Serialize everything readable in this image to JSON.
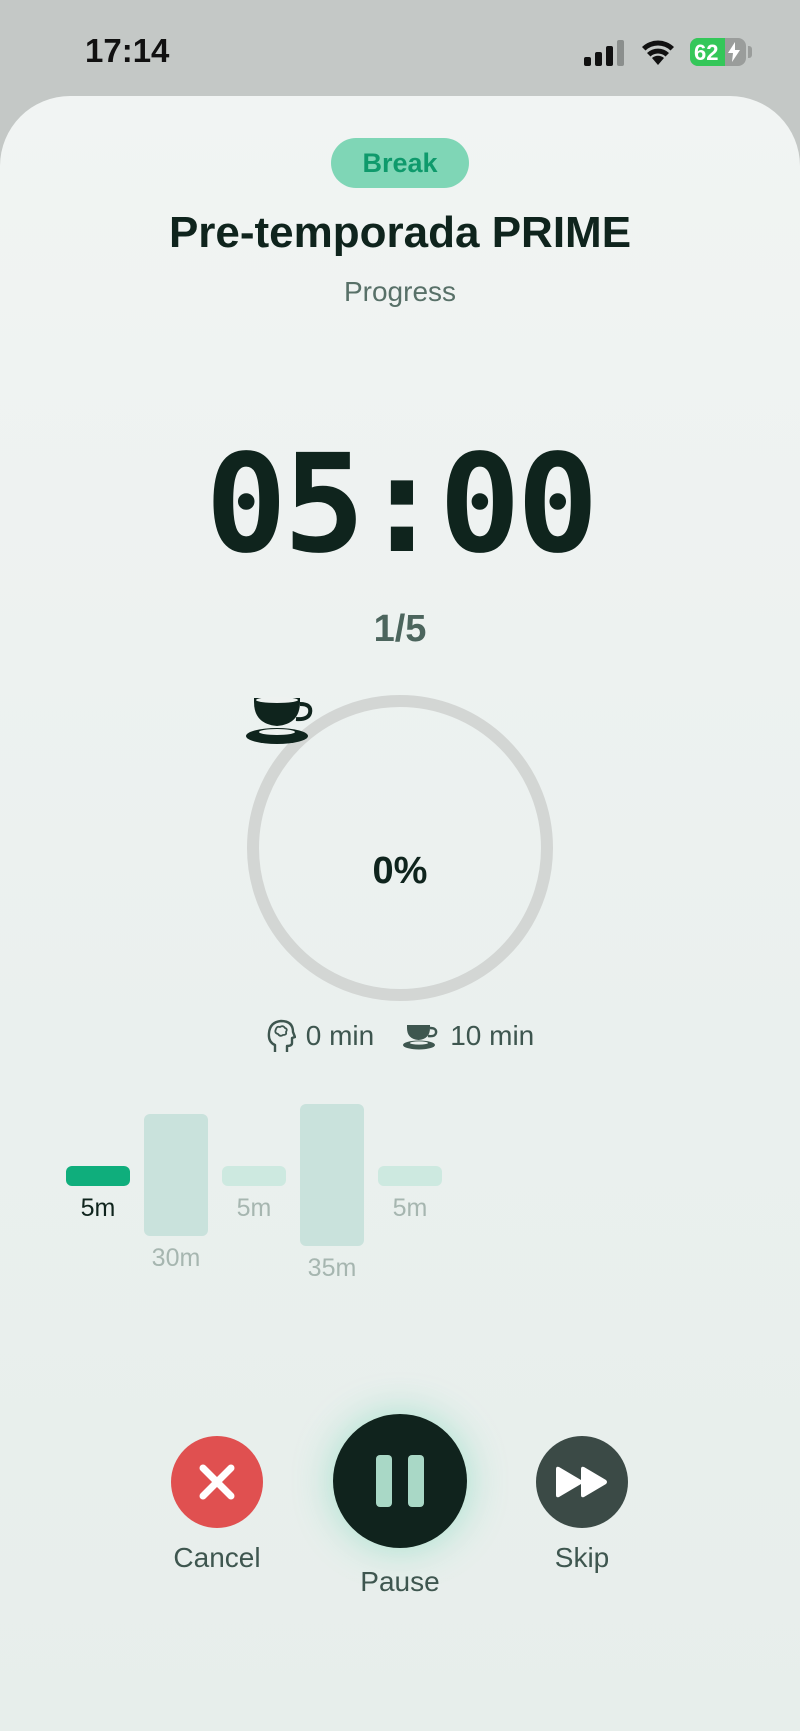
{
  "status_bar": {
    "time": "17:14",
    "battery_percent": "62",
    "battery_level": 0.62,
    "charging": true,
    "icons": [
      "signal-icon",
      "wifi-icon",
      "battery-icon",
      "bolt-icon"
    ]
  },
  "session": {
    "badge": "Break",
    "title": "Pre-temporada PRIME",
    "subtitle": "Progress",
    "timer": "05:00",
    "round": "1/5"
  },
  "progress_ring": {
    "icon": "coffee-cup-icon",
    "percent_label": "0%",
    "percent": 0
  },
  "stats": {
    "focus_icon": "brain-head-icon",
    "focus_value": "0 min",
    "break_icon": "coffee-cup-icon",
    "break_value": "10 min"
  },
  "timeline": {
    "segments": [
      {
        "label": "5m",
        "type": "break",
        "minutes": 5,
        "active": true
      },
      {
        "label": "30m",
        "type": "focus",
        "minutes": 30,
        "active": false
      },
      {
        "label": "5m",
        "type": "break",
        "minutes": 5,
        "active": false
      },
      {
        "label": "35m",
        "type": "focus",
        "minutes": 35,
        "active": false
      },
      {
        "label": "5m",
        "type": "break",
        "minutes": 5,
        "active": false
      }
    ]
  },
  "controls": {
    "cancel_label": "Cancel",
    "pause_label": "Pause",
    "skip_label": "Skip"
  },
  "colors": {
    "accent": "#0fae7c",
    "badge_bg": "#7fd6b6",
    "cancel": "#e05050",
    "pause": "#10231d",
    "skip": "#3b4a46",
    "ring_track": "#d3d6d4"
  }
}
